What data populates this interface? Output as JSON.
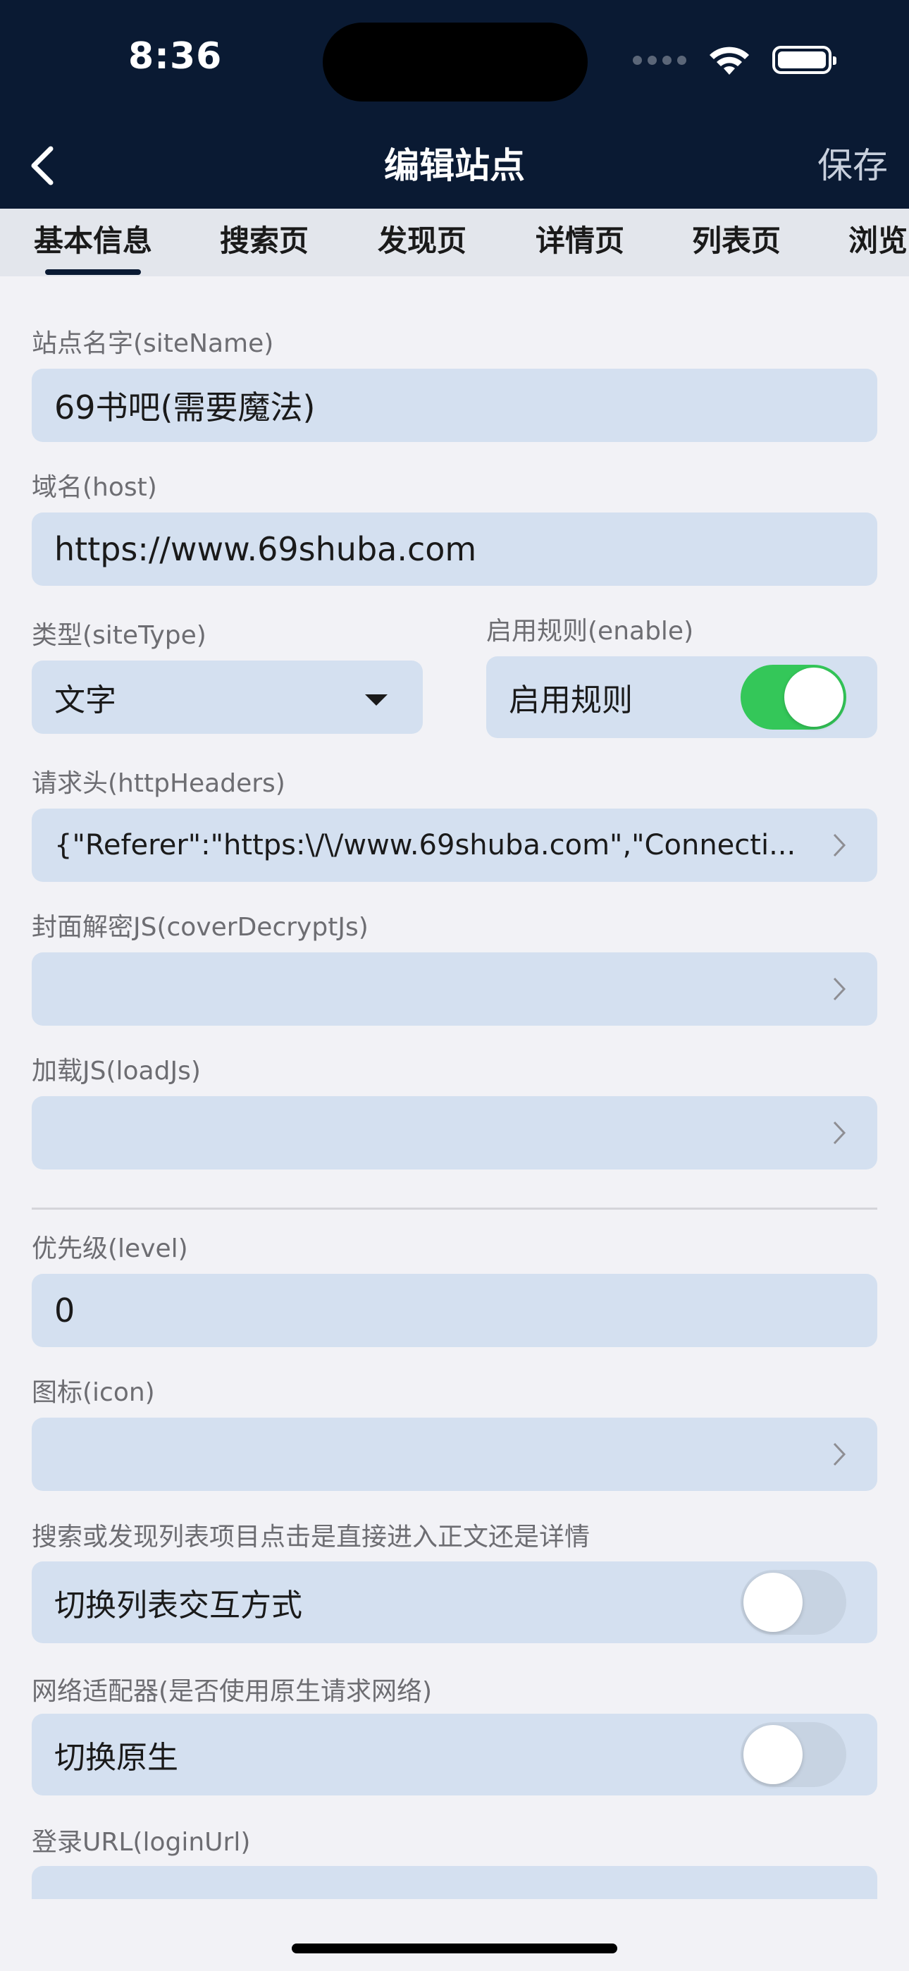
{
  "status_bar": {
    "time": "8:36"
  },
  "nav": {
    "title": "编辑站点",
    "save_label": "保存"
  },
  "tabs": [
    {
      "label": "基本信息",
      "active": true
    },
    {
      "label": "搜索页"
    },
    {
      "label": "发现页"
    },
    {
      "label": "详情页"
    },
    {
      "label": "列表页"
    },
    {
      "label": "浏览"
    }
  ],
  "fields": {
    "site_name": {
      "label": "站点名字(siteName)",
      "value": "69书吧(需要魔法)"
    },
    "host": {
      "label": "域名(host)",
      "value": "https://www.69shuba.com"
    },
    "site_type": {
      "label": "类型(siteType)",
      "value": "文字"
    },
    "enable": {
      "label": "启用规则(enable)",
      "toggle_label": "启用规则",
      "on": true
    },
    "http_headers": {
      "label": "请求头(httpHeaders)",
      "value": "{\"Referer\":\"https:\\/\\/www.69shuba.com\",\"Connecti..."
    },
    "cover_decrypt_js": {
      "label": "封面解密JS(coverDecryptJs)",
      "value": ""
    },
    "load_js": {
      "label": "加载JS(loadJs)",
      "value": ""
    },
    "level": {
      "label": "优先级(level)",
      "value": "0"
    },
    "icon": {
      "label": "图标(icon)",
      "value": ""
    },
    "list_interaction": {
      "label": "搜索或发现列表项目点击是直接进入正文还是详情",
      "toggle_label": "切换列表交互方式",
      "on": false
    },
    "network_adapter": {
      "label": "网络适配器(是否使用原生请求网络)",
      "toggle_label": "切换原生",
      "on": false
    },
    "login_url": {
      "label": "登录URL(loginUrl)",
      "value": ""
    }
  },
  "colors": {
    "header_bg": "#0a1a33",
    "field_bg": "#d4e0f0",
    "toggle_on": "#34c759"
  }
}
